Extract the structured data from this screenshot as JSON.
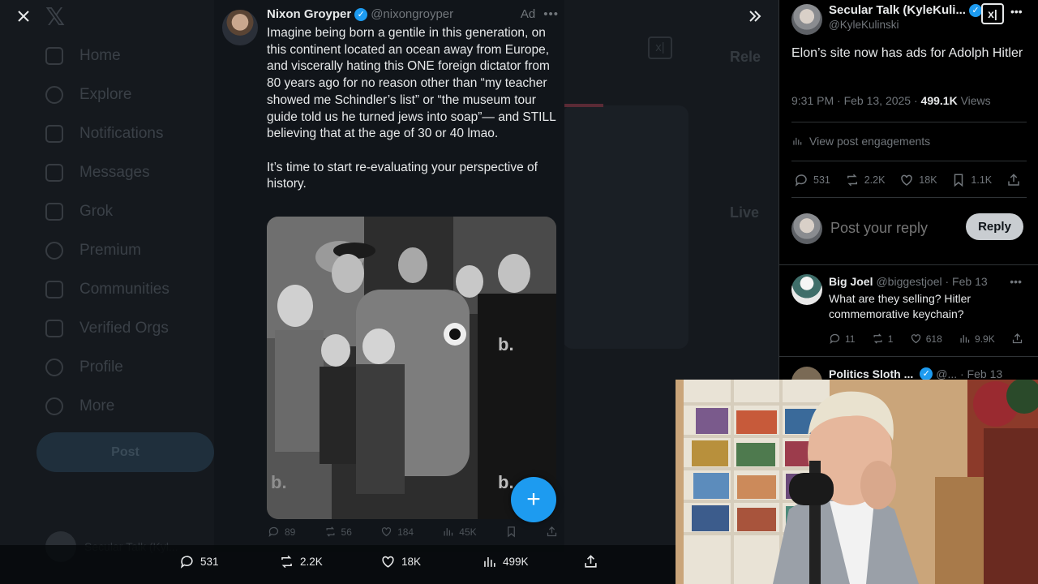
{
  "background_app": {
    "nav_items": [
      "Home",
      "Explore",
      "Notifications",
      "Messages",
      "Grok",
      "Premium",
      "Communities",
      "Verified Orgs",
      "Profile",
      "More"
    ],
    "post_button": "Post",
    "profile_name": "Secular Talk (Kyl...",
    "right_heading": "Rele",
    "live_heading": "Live"
  },
  "ad_post": {
    "name": "Nixon Groyper",
    "handle": "@nixongroyper",
    "ad_label": "Ad",
    "paragraph1": "Imagine being born a gentile in this generation, on this continent located an ocean away from Europe, and viscerally hating this ONE foreign dictator from 80 years ago for no reason other than “my teacher showed me Schindler’s list” or “the museum tour guide told us he turned jews into soap”— and STILL believing that at the age of 30 or 40 lmao.",
    "paragraph2": "It’s time to start re-evaluating your perspective of history.",
    "actions": {
      "replies": "89",
      "reposts": "56",
      "likes": "184",
      "views": "45K"
    }
  },
  "bottom_bar": {
    "replies": "531",
    "reposts": "2.2K",
    "likes": "18K",
    "views": "499K"
  },
  "right_panel": {
    "name": "Secular Talk (KyleKuli...",
    "handle": "@KyleKulinski",
    "text": "Elon’s site now has ads for Adolph Hitler",
    "time": "9:31 PM · Feb 13, 2025 ·",
    "views_count": "499.1K",
    "views_label": "Views",
    "engagements": "View post engagements",
    "actions": {
      "replies": "531",
      "reposts": "2.2K",
      "likes": "18K",
      "bookmarks": "1.1K"
    },
    "reply_placeholder": "Post your reply",
    "reply_button": "Reply",
    "replies": [
      {
        "name": "Big Joel",
        "handle": "@biggestjoel · Feb 13",
        "text": "What are they selling? Hitler commemorative keychain?",
        "replies": "11",
        "reposts": "1",
        "likes": "618",
        "views": "9.9K"
      },
      {
        "name": "Politics Sloth ...",
        "handle": "@... · Feb 13"
      }
    ]
  },
  "colors": {
    "accent": "#1d9bf0",
    "background": "#000000",
    "muted": "#71767b"
  }
}
